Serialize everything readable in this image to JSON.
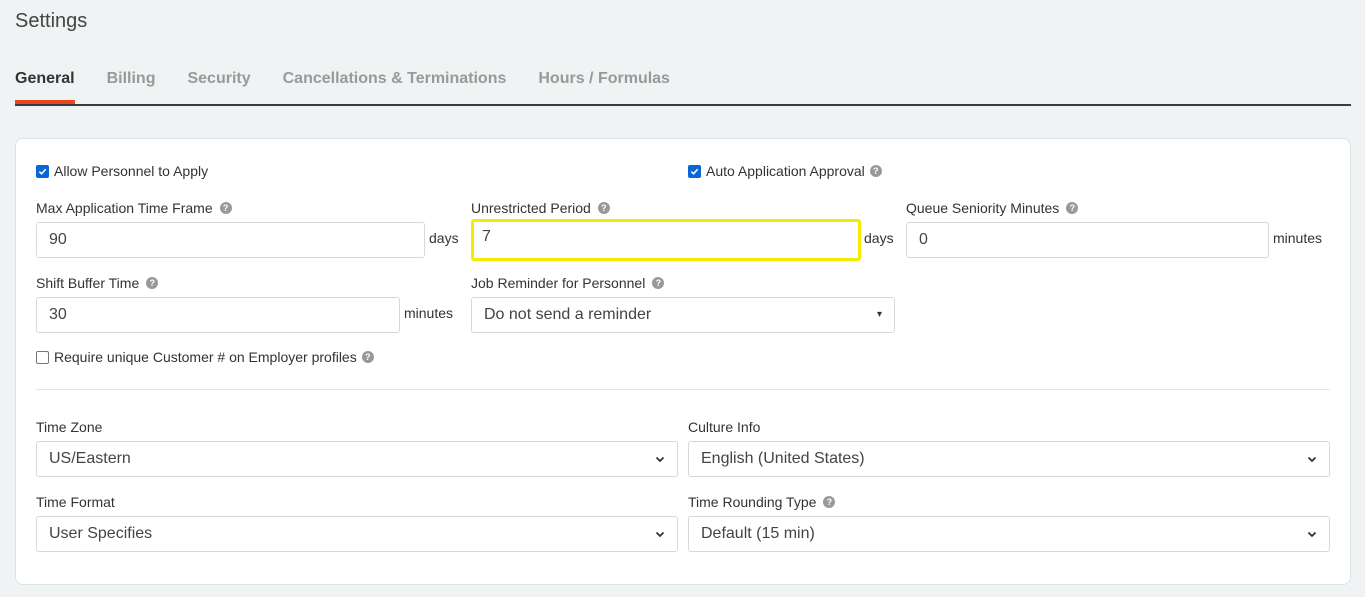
{
  "page": {
    "title": "Settings"
  },
  "tabs": [
    {
      "label": "General",
      "active": true
    },
    {
      "label": "Billing",
      "active": false
    },
    {
      "label": "Security",
      "active": false
    },
    {
      "label": "Cancellations & Terminations",
      "active": false
    },
    {
      "label": "Hours / Formulas",
      "active": false
    }
  ],
  "colors": {
    "accent": "#e8491d",
    "highlight": "#f5ea00",
    "checkbox": "#0a66d6"
  },
  "general": {
    "allow_personnel": {
      "label": "Allow Personnel to Apply",
      "checked": true
    },
    "auto_approval": {
      "label": "Auto Application Approval",
      "checked": true
    },
    "max_app_time": {
      "label": "Max Application Time Frame",
      "value": "90",
      "suffix": "days"
    },
    "unrestricted_period": {
      "label": "Unrestricted Period",
      "value": "7",
      "suffix": "days"
    },
    "queue_seniority": {
      "label": "Queue Seniority Minutes",
      "value": "0",
      "suffix": "minutes"
    },
    "shift_buffer": {
      "label": "Shift Buffer Time",
      "value": "30",
      "suffix": "minutes"
    },
    "job_reminder": {
      "label": "Job Reminder for Personnel",
      "value": "Do not send a reminder"
    },
    "unique_customer": {
      "label": "Require unique Customer # on Employer profiles",
      "checked": false
    },
    "time_zone": {
      "label": "Time Zone",
      "value": "US/Eastern"
    },
    "culture_info": {
      "label": "Culture Info",
      "value": "English (United States)"
    },
    "time_format": {
      "label": "Time Format",
      "value": "User Specifies"
    },
    "time_rounding": {
      "label": "Time Rounding Type",
      "value": "Default (15 min)"
    }
  },
  "icons": {
    "help": "?",
    "caret": "▾"
  }
}
